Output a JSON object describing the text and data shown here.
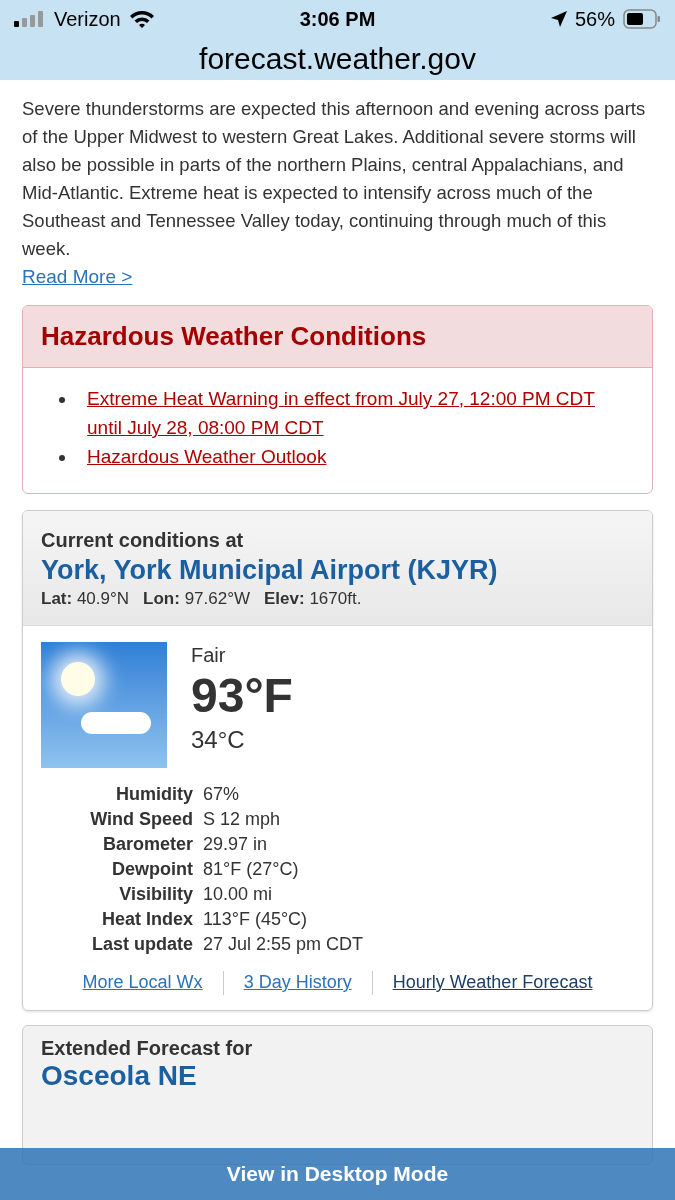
{
  "status_bar": {
    "carrier": "Verizon",
    "time": "3:06 PM",
    "battery": "56%"
  },
  "address_bar": {
    "url": "forecast.weather.gov"
  },
  "summary": {
    "text": "Severe thunderstorms are expected this afternoon and evening across parts of the Upper Midwest to western Great Lakes. Additional severe storms will also be possible in parts of the northern Plains, central Appalachians, and Mid-Atlantic. Extreme heat is expected to intensify across much of the Southeast and Tennessee Valley today, continuing through much of this week.",
    "link": "Read More >"
  },
  "hazards": {
    "title": "Hazardous Weather Conditions",
    "items": [
      "Extreme Heat Warning in effect from July 27, 12:00 PM CDT until July 28, 08:00 PM CDT",
      "Hazardous Weather Outlook"
    ]
  },
  "current": {
    "heading": "Current conditions at",
    "station": "York, York Municipal Airport (KJYR)",
    "coords": [
      {
        "label": "Lat:",
        "value": "40.9°N"
      },
      {
        "label": "Lon:",
        "value": "97.62°W"
      },
      {
        "label": "Elev:",
        "value": "1670ft."
      }
    ],
    "condition": "Fair",
    "temp_f": "93°F",
    "temp_c": "34°C",
    "details": [
      {
        "label": "Humidity",
        "value": "67%"
      },
      {
        "label": "Wind Speed",
        "value": "S 12 mph"
      },
      {
        "label": "Barometer",
        "value": "29.97 in"
      },
      {
        "label": "Dewpoint",
        "value": "81°F (27°C)"
      },
      {
        "label": "Visibility",
        "value": "10.00 mi"
      },
      {
        "label": "Heat Index",
        "value": "113°F (45°C)"
      },
      {
        "label": "Last update",
        "value": "27 Jul 2:55 pm CDT"
      }
    ],
    "links": [
      {
        "label": "More Local Wx",
        "selected": false
      },
      {
        "label": "3 Day History",
        "selected": false
      },
      {
        "label": "Hourly Weather Forecast",
        "selected": true
      }
    ]
  },
  "extended": {
    "heading": "Extended Forecast for",
    "place": "Osceola NE"
  },
  "desktop_bar": {
    "label": "View in Desktop Mode"
  }
}
